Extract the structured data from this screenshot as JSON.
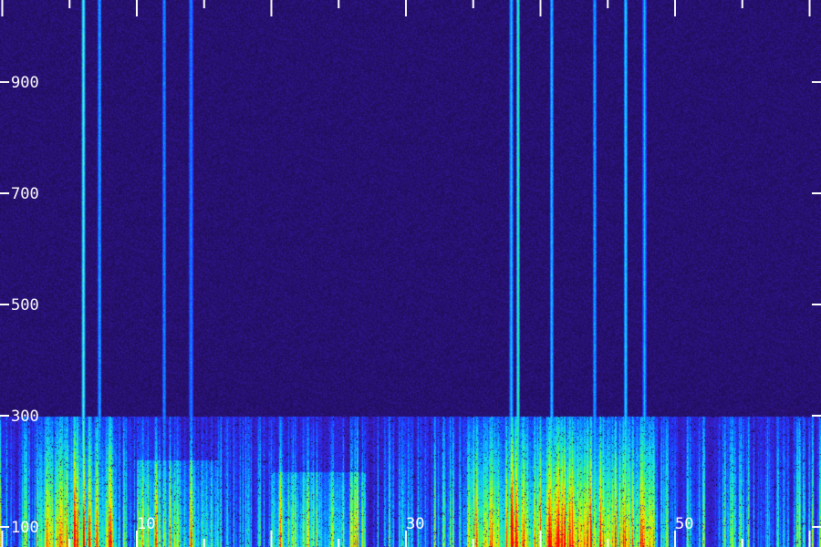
{
  "chart_data": {
    "type": "heatmap",
    "colormap": [
      "#000000",
      "#1a0840",
      "#25106a",
      "#3a1bb8",
      "#2432ff",
      "#0a7cff",
      "#12d0ff",
      "#22f0a0",
      "#90ff20",
      "#ffe800",
      "#ff6000",
      "#ff0000"
    ],
    "background_color": "#1e0c4a",
    "y_ticks": [
      {
        "value": 100,
        "label": "100"
      },
      {
        "value": 300,
        "label": "300"
      },
      {
        "value": 500,
        "label": "500"
      },
      {
        "value": 700,
        "label": "700"
      },
      {
        "value": 900,
        "label": "900"
      }
    ],
    "x_ticks": [
      {
        "value": 10,
        "label": "10"
      },
      {
        "value": 30,
        "label": "30"
      },
      {
        "value": 50,
        "label": "50"
      }
    ],
    "ylim": [
      100,
      1000
    ],
    "xlim": [
      0,
      60
    ],
    "minor_x_tick_step": 5,
    "low_band_upper_edge": 300,
    "tonal_lines": [
      {
        "x": 6.0,
        "strength": 1.0
      },
      {
        "x": 7.2,
        "strength": 0.5
      },
      {
        "x": 12.0,
        "strength": 0.4
      },
      {
        "x": 14.0,
        "strength": 0.35
      },
      {
        "x": 38.3,
        "strength": 0.95
      },
      {
        "x": 37.8,
        "strength": 0.6
      },
      {
        "x": 40.8,
        "strength": 0.6
      },
      {
        "x": 44.0,
        "strength": 0.5
      },
      {
        "x": 46.3,
        "strength": 0.7
      },
      {
        "x": 47.7,
        "strength": 0.55
      }
    ],
    "hot_regions": [
      {
        "x_start": 2.5,
        "x_end": 8.5,
        "y_top": 300,
        "intensity": 0.8
      },
      {
        "x_start": 34.5,
        "x_end": 48.5,
        "y_top": 300,
        "intensity": 0.9
      },
      {
        "x_start": 10.0,
        "x_end": 16.0,
        "y_top": 220,
        "intensity": 0.55
      },
      {
        "x_start": 20.0,
        "x_end": 27.0,
        "y_top": 200,
        "intensity": 0.5
      }
    ]
  }
}
